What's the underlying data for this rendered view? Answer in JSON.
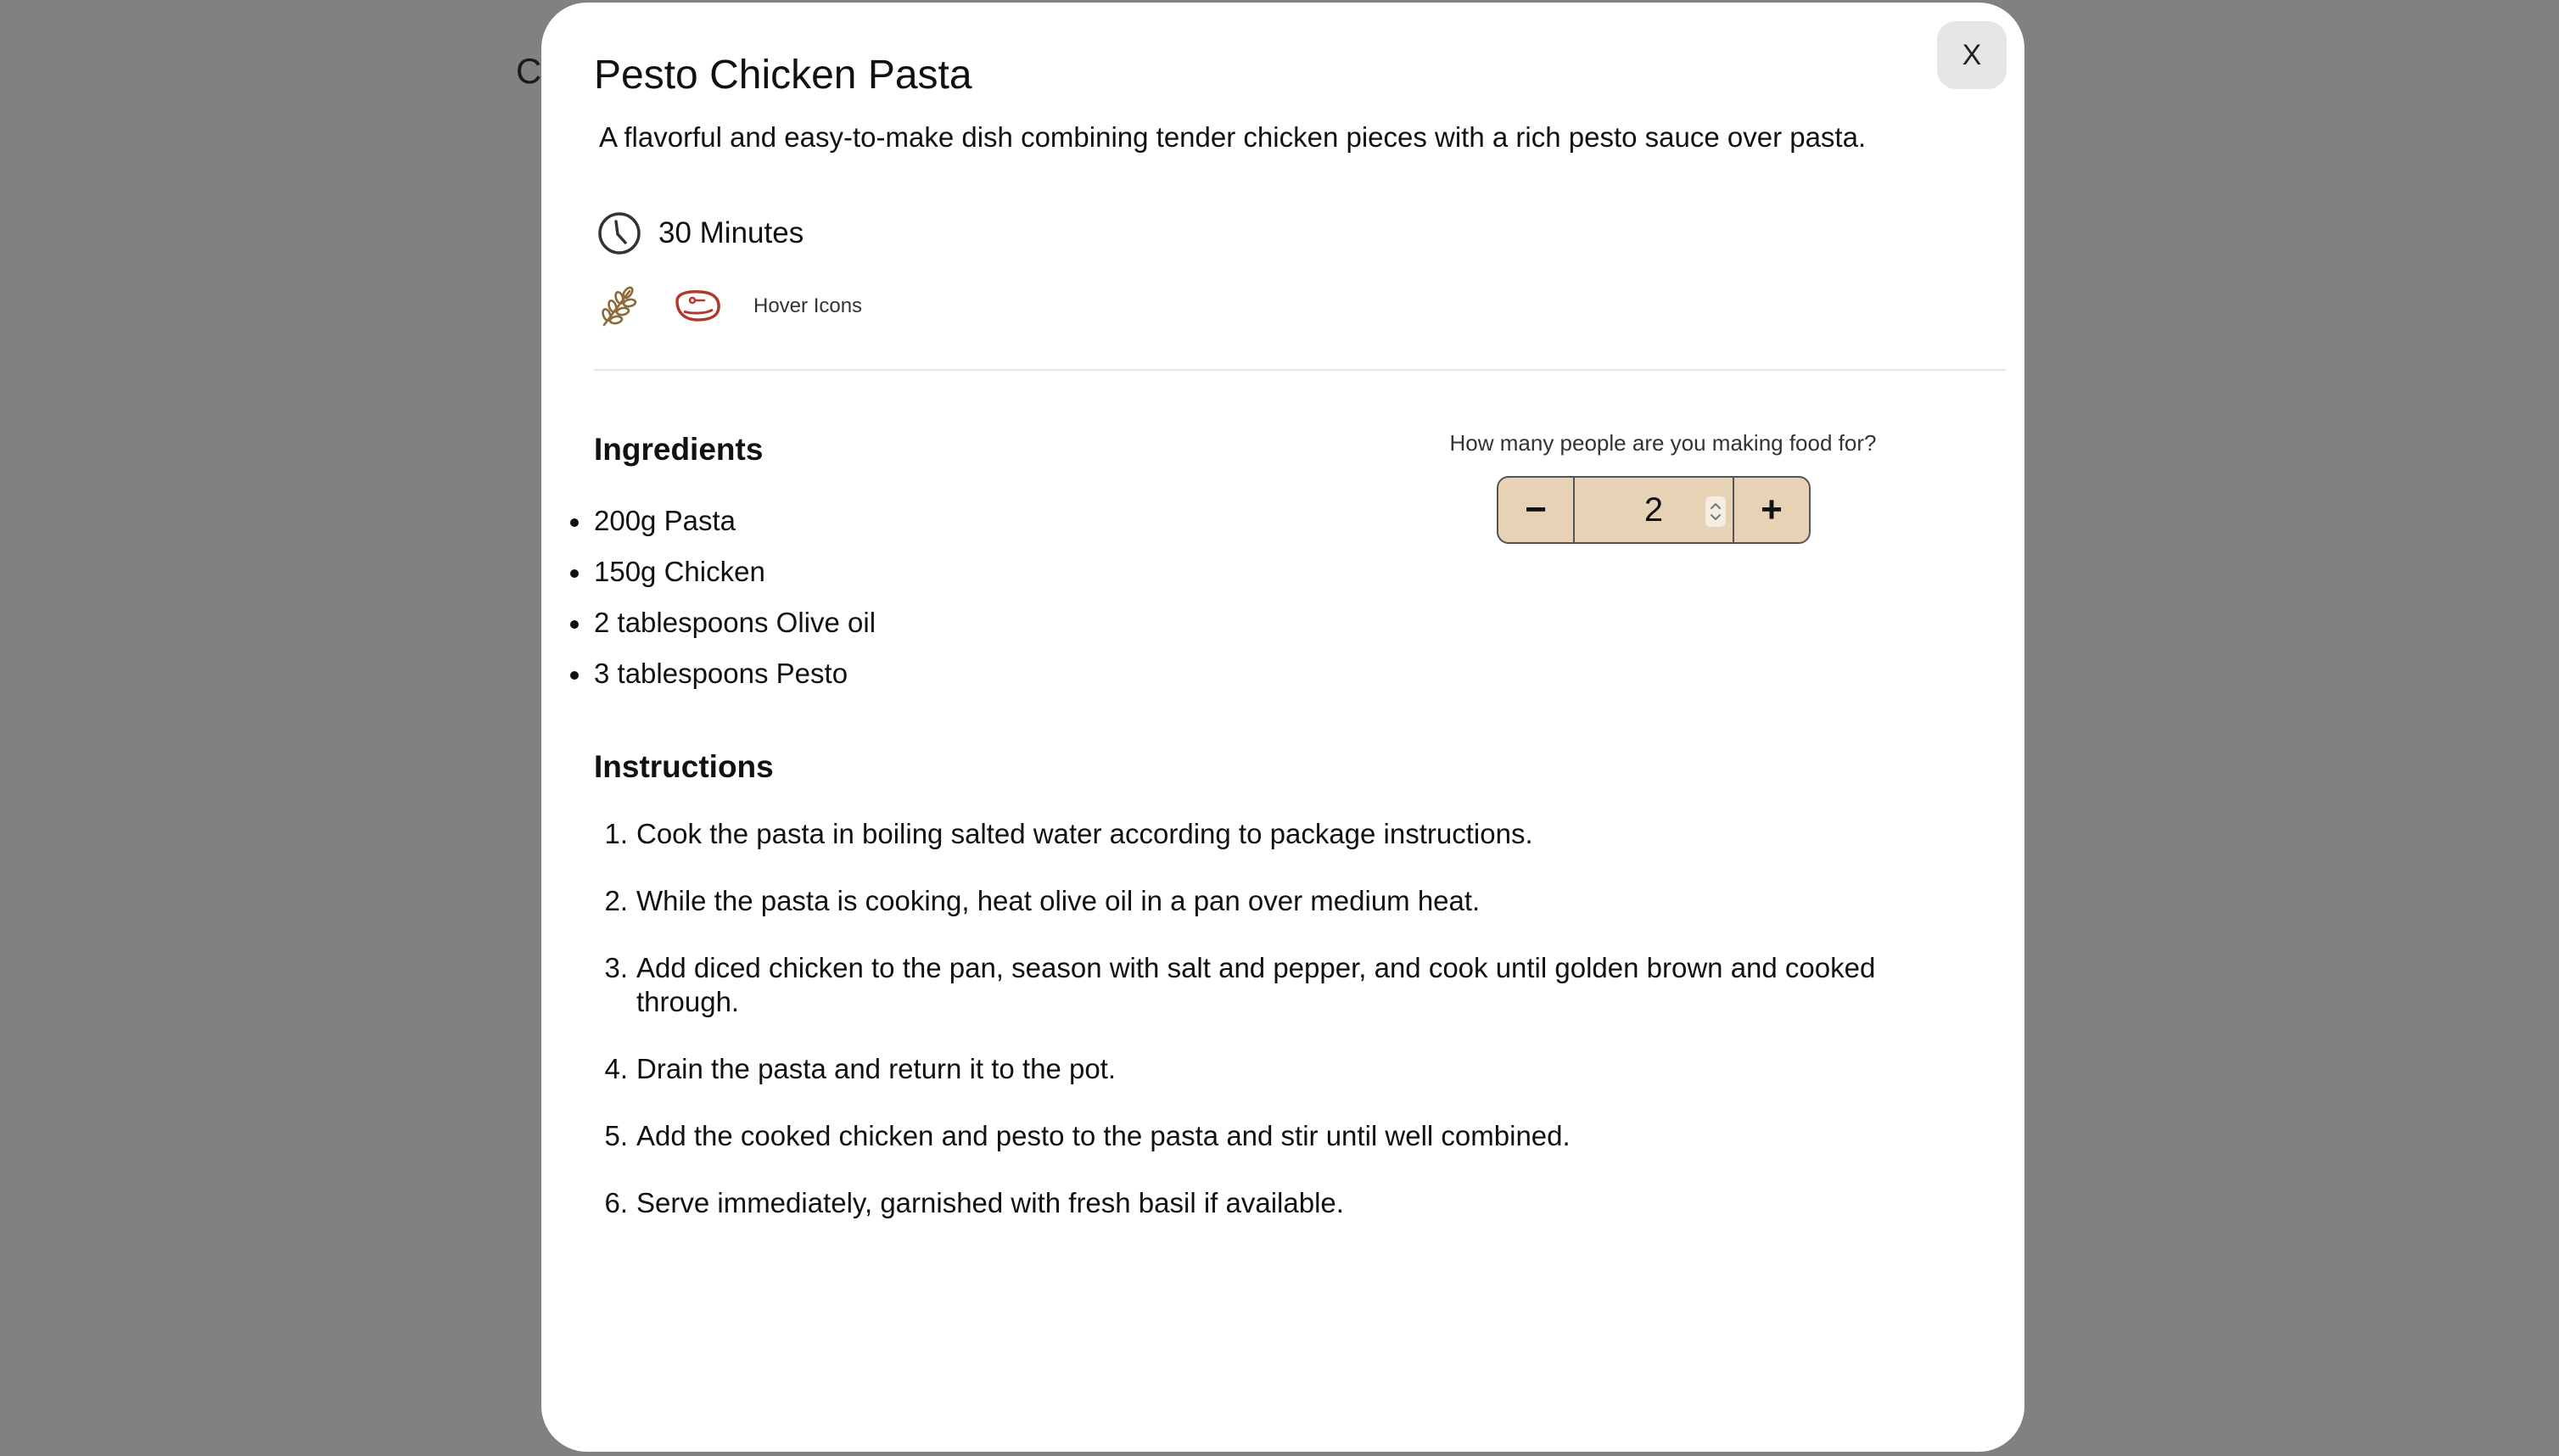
{
  "background": {
    "peek_text": "C"
  },
  "modal": {
    "close_label": "X",
    "title": "Pesto Chicken Pasta",
    "description": "A flavorful and easy-to-make dish combining tender chicken pieces with a rich pesto sauce over pasta.",
    "time": "30 Minutes",
    "tags": {
      "icons": [
        "wheat-icon",
        "meat-icon"
      ],
      "hover_label": "Hover Icons"
    },
    "ingredients_heading": "Ingredients",
    "ingredients": [
      "200g Pasta",
      "150g Chicken",
      "2 tablespoons Olive oil",
      "3 tablespoons Pesto"
    ],
    "servings": {
      "question": "How many people are you making food for?",
      "decrement_label": "−",
      "value": "2",
      "increment_label": "+"
    },
    "instructions_heading": "Instructions",
    "instructions": [
      {
        "num": "1.",
        "text": "Cook the pasta in boiling salted water according to package instructions."
      },
      {
        "num": "2.",
        "text": "While the pasta is cooking, heat olive oil in a pan over medium heat."
      },
      {
        "num": "3.",
        "text": "Add diced chicken to the pan, season with salt and pepper, and cook until golden brown and cooked through."
      },
      {
        "num": "4.",
        "text": "Drain the pasta and return it to the pot."
      },
      {
        "num": "5.",
        "text": "Add the cooked chicken and pesto to the pasta and stir until well combined."
      },
      {
        "num": "6.",
        "text": "Serve immediately, garnished with fresh basil if available."
      }
    ]
  },
  "colors": {
    "backdrop": "#818181",
    "modal_bg": "#ffffff",
    "stepper_bg": "#e8d2b5",
    "meat_icon": "#b03a2e",
    "wheat_icon": "#8a6a3a"
  }
}
